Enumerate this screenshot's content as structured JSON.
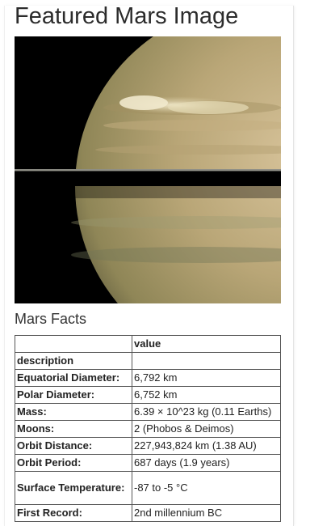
{
  "page": {
    "title": "Featured Mars Image"
  },
  "featured_image": {
    "subject": "Saturn with storm and rings"
  },
  "facts": {
    "heading": "Mars Facts",
    "table": {
      "header_blank": "",
      "header_value": "value",
      "index_label": "description",
      "rows": [
        {
          "label": "Equatorial Diameter:",
          "value": "6,792 km"
        },
        {
          "label": "Polar Diameter:",
          "value": "6,752 km"
        },
        {
          "label": "Mass:",
          "value": "6.39 × 10^23 kg (0.11 Earths)"
        },
        {
          "label": "Moons:",
          "value": "2 (Phobos & Deimos)"
        },
        {
          "label": "Orbit Distance:",
          "value": "227,943,824 km (1.38 AU)"
        },
        {
          "label": "Orbit Period:",
          "value": "687 days (1.9 years)"
        },
        {
          "label": "Surface Temperature:",
          "value": "-87 to -5 °C"
        },
        {
          "label": "First Record:",
          "value": "2nd millennium BC"
        }
      ]
    }
  }
}
